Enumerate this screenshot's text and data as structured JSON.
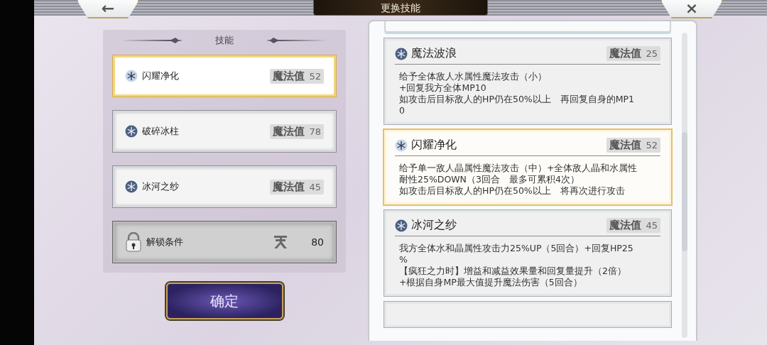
{
  "title": "更换技能",
  "back_button": "←",
  "close_button": "×",
  "skills_panel": {
    "heading": "技能",
    "slots": [
      {
        "kind": "skill",
        "name": "闪耀净化",
        "cost_label": "魔法值",
        "cost": "52",
        "selected": true
      },
      {
        "kind": "skill",
        "name": "破碎冰柱",
        "cost_label": "魔法值",
        "cost": "78",
        "selected": false
      },
      {
        "kind": "skill",
        "name": "冰河之纱",
        "cost_label": "魔法值",
        "cost": "45",
        "selected": false
      },
      {
        "kind": "locked",
        "name": "解锁条件",
        "cost": "80"
      }
    ]
  },
  "confirm_button": "确定",
  "skill_list": {
    "more_below": true,
    "cards": [
      {
        "name": "魔法波浪",
        "cost_label": "魔法值",
        "cost": "25",
        "selected": false,
        "lines": [
          "给予全体敌人水属性魔法攻击（小）",
          "+回复我方全体MP10",
          "如攻击后目标敌人的HP仍在50%以上　再回复自身的MP1",
          "0"
        ]
      },
      {
        "name": "闪耀净化",
        "cost_label": "魔法值",
        "cost": "52",
        "selected": true,
        "lines": [
          "给予单一敌人晶属性魔法攻击（中）+全体敌人晶和水属性",
          "耐性25%DOWN（3回合　最多可累积4次）",
          "如攻击后目标敌人的HP仍在50%以上　将再次进行攻击"
        ]
      },
      {
        "name": "冰河之纱",
        "cost_label": "魔法值",
        "cost": "45",
        "selected": false,
        "lines": [
          "我方全体水和晶属性攻击力25%UP（5回合）+回复HP25",
          "%",
          "【疯狂之力时】增益和减益效果量和回复量提升（2倍）",
          "+根据自身MP最大值提升魔法伤害（5回合）"
        ]
      }
    ]
  }
}
